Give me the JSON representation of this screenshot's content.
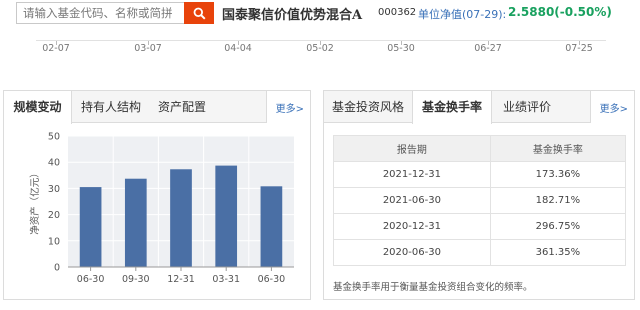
{
  "header": {
    "search_placeholder": "请输入基金代码、名称或简拼",
    "fund_name": "国泰聚信价值优势混合A",
    "fund_code": "000362",
    "nav_label": "单位净值(07-29):",
    "nav_value": "2.5880(-0.50%)"
  },
  "timeline": {
    "labels": [
      "02-07",
      "03-07",
      "04-04",
      "05-02",
      "05-30",
      "06-27",
      "07-25"
    ]
  },
  "left_panel": {
    "tabs": [
      {
        "label": "规模变动"
      },
      {
        "label": "持有人结构"
      },
      {
        "label": "资产配置"
      }
    ],
    "more": "更多>"
  },
  "right_panel": {
    "tabs": [
      {
        "label": "基金投资风格"
      },
      {
        "label": "基金换手率"
      },
      {
        "label": "业绩评价"
      }
    ],
    "more": "更多>",
    "table": {
      "headers": [
        "报告期",
        "基金换手率"
      ],
      "rows": [
        [
          "2021-12-31",
          "173.36%"
        ],
        [
          "2021-06-30",
          "182.71%"
        ],
        [
          "2020-12-31",
          "296.75%"
        ],
        [
          "2020-06-30",
          "361.35%"
        ]
      ]
    },
    "note": "基金换手率用于衡量基金投资组合变化的频率。"
  },
  "colors": {
    "accent": "#e8430b",
    "bar": "#4a6fa5",
    "link": "#3a71b8",
    "nav_value": "#19a15f"
  },
  "chart_data": {
    "type": "bar",
    "categories": [
      "06-30",
      "09-30",
      "12-31",
      "03-31",
      "06-30"
    ],
    "values": [
      30.5,
      33.7,
      37.3,
      38.7,
      30.8
    ],
    "ylabel": "净资产（亿元）",
    "ylim": [
      0,
      50
    ],
    "yticks": [
      0,
      10,
      20,
      30,
      40,
      50
    ],
    "grid": true
  }
}
